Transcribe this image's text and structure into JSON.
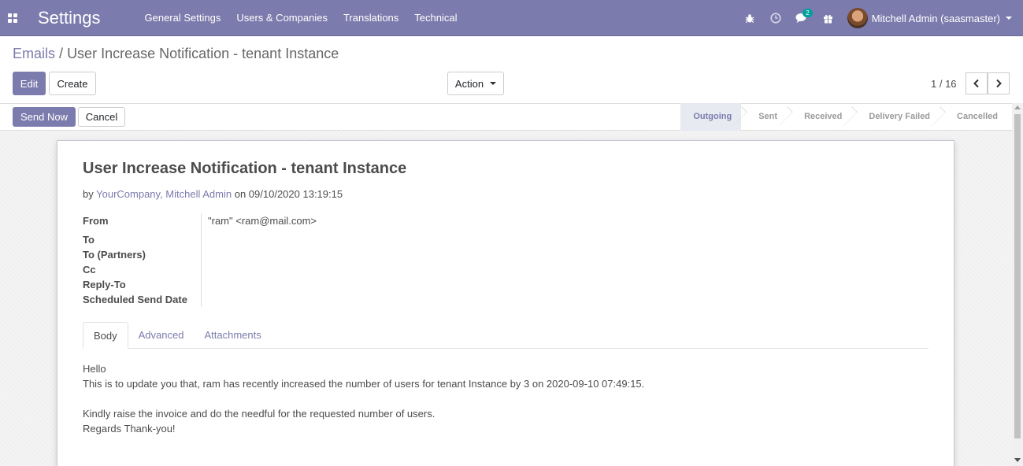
{
  "navbar": {
    "app_title": "Settings",
    "menu": [
      "General Settings",
      "Users & Companies",
      "Translations",
      "Technical"
    ],
    "messages_badge": "2",
    "user_name": "Mitchell Admin (saasmaster)"
  },
  "breadcrumb": {
    "parent": "Emails",
    "separator": "/",
    "current": "User Increase Notification - tenant Instance"
  },
  "buttons": {
    "edit": "Edit",
    "create": "Create",
    "action": "Action",
    "send_now": "Send Now",
    "cancel": "Cancel"
  },
  "pager": {
    "value": "1 / 16"
  },
  "stages": [
    "Outgoing",
    "Sent",
    "Received",
    "Delivery Failed",
    "Cancelled"
  ],
  "mail": {
    "subject": "User Increase Notification - tenant Instance",
    "by_prefix": "by",
    "author": "YourCompany, Mitchell Admin",
    "date_text": "on 09/10/2020 13:19:15",
    "fields": {
      "from_label": "From",
      "from_value": "\"ram\" <ram@mail.com>",
      "to_label": "To",
      "to_partners_label": "To (Partners)",
      "cc_label": "Cc",
      "reply_to_label": "Reply-To",
      "scheduled_label": "Scheduled Send Date"
    },
    "tabs": [
      "Body",
      "Advanced",
      "Attachments"
    ],
    "body": {
      "line1": "Hello",
      "line2": "This is to update you that, ram has recently increased the number of users for tenant Instance by 3 on 2020-09-10 07:49:15.",
      "line3": "Kindly raise the invoice and do the needful for the requested number of users.",
      "line4": "Regards Thank-you!"
    }
  },
  "colors": {
    "navbar": "#7c7bad",
    "primary": "#7c7bad",
    "badge": "#00a09d"
  },
  "icons": [
    "apps-icon",
    "bug-icon",
    "clock-icon",
    "chat-icon",
    "gift-icon",
    "chevron-left-icon",
    "chevron-right-icon"
  ]
}
